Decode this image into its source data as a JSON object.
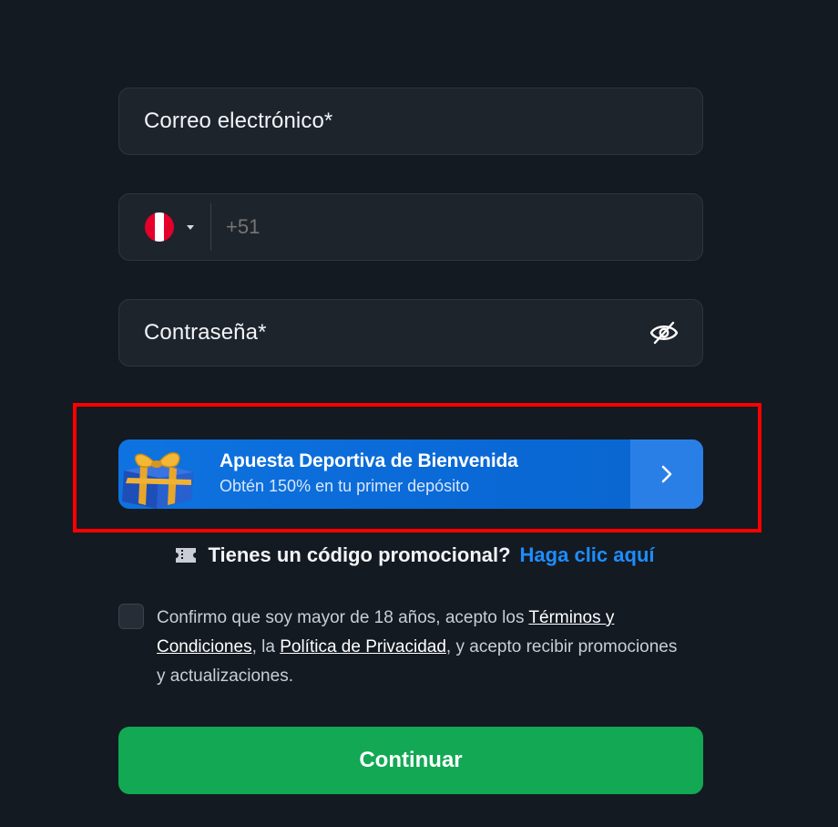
{
  "form": {
    "email_label": "Correo electrónico*",
    "phone": {
      "country_flag": "peru-flag-icon",
      "prefix": "+51"
    },
    "password_label": "Contraseña*",
    "password_toggle_icon": "eye-slash-icon"
  },
  "promo_banner": {
    "title": "Apuesta Deportiva de Bienvenida",
    "subtitle": "Obtén 150% en tu primer depósito",
    "icon": "gift-box-icon",
    "arrow_icon": "chevron-right-icon",
    "accent": "#0a69d6"
  },
  "promo_code": {
    "question": "Tienes un código promocional?",
    "link": "Haga clic aquí",
    "icon": "ticket-icon",
    "link_color": "#1d8dff"
  },
  "consent": {
    "text_1": "Confirmo que soy mayor de 18 años, acepto los ",
    "terms_link": "Términos y Condiciones",
    "text_2": ", la ",
    "privacy_link": "Política de Privacidad",
    "text_3": ", y acepto recibir promociones y actualizaciones."
  },
  "continue_label": "Continuar",
  "colors": {
    "background": "#141a22",
    "field": "#1e242c",
    "primary_button": "#12a854",
    "highlight": "#ff0000"
  }
}
